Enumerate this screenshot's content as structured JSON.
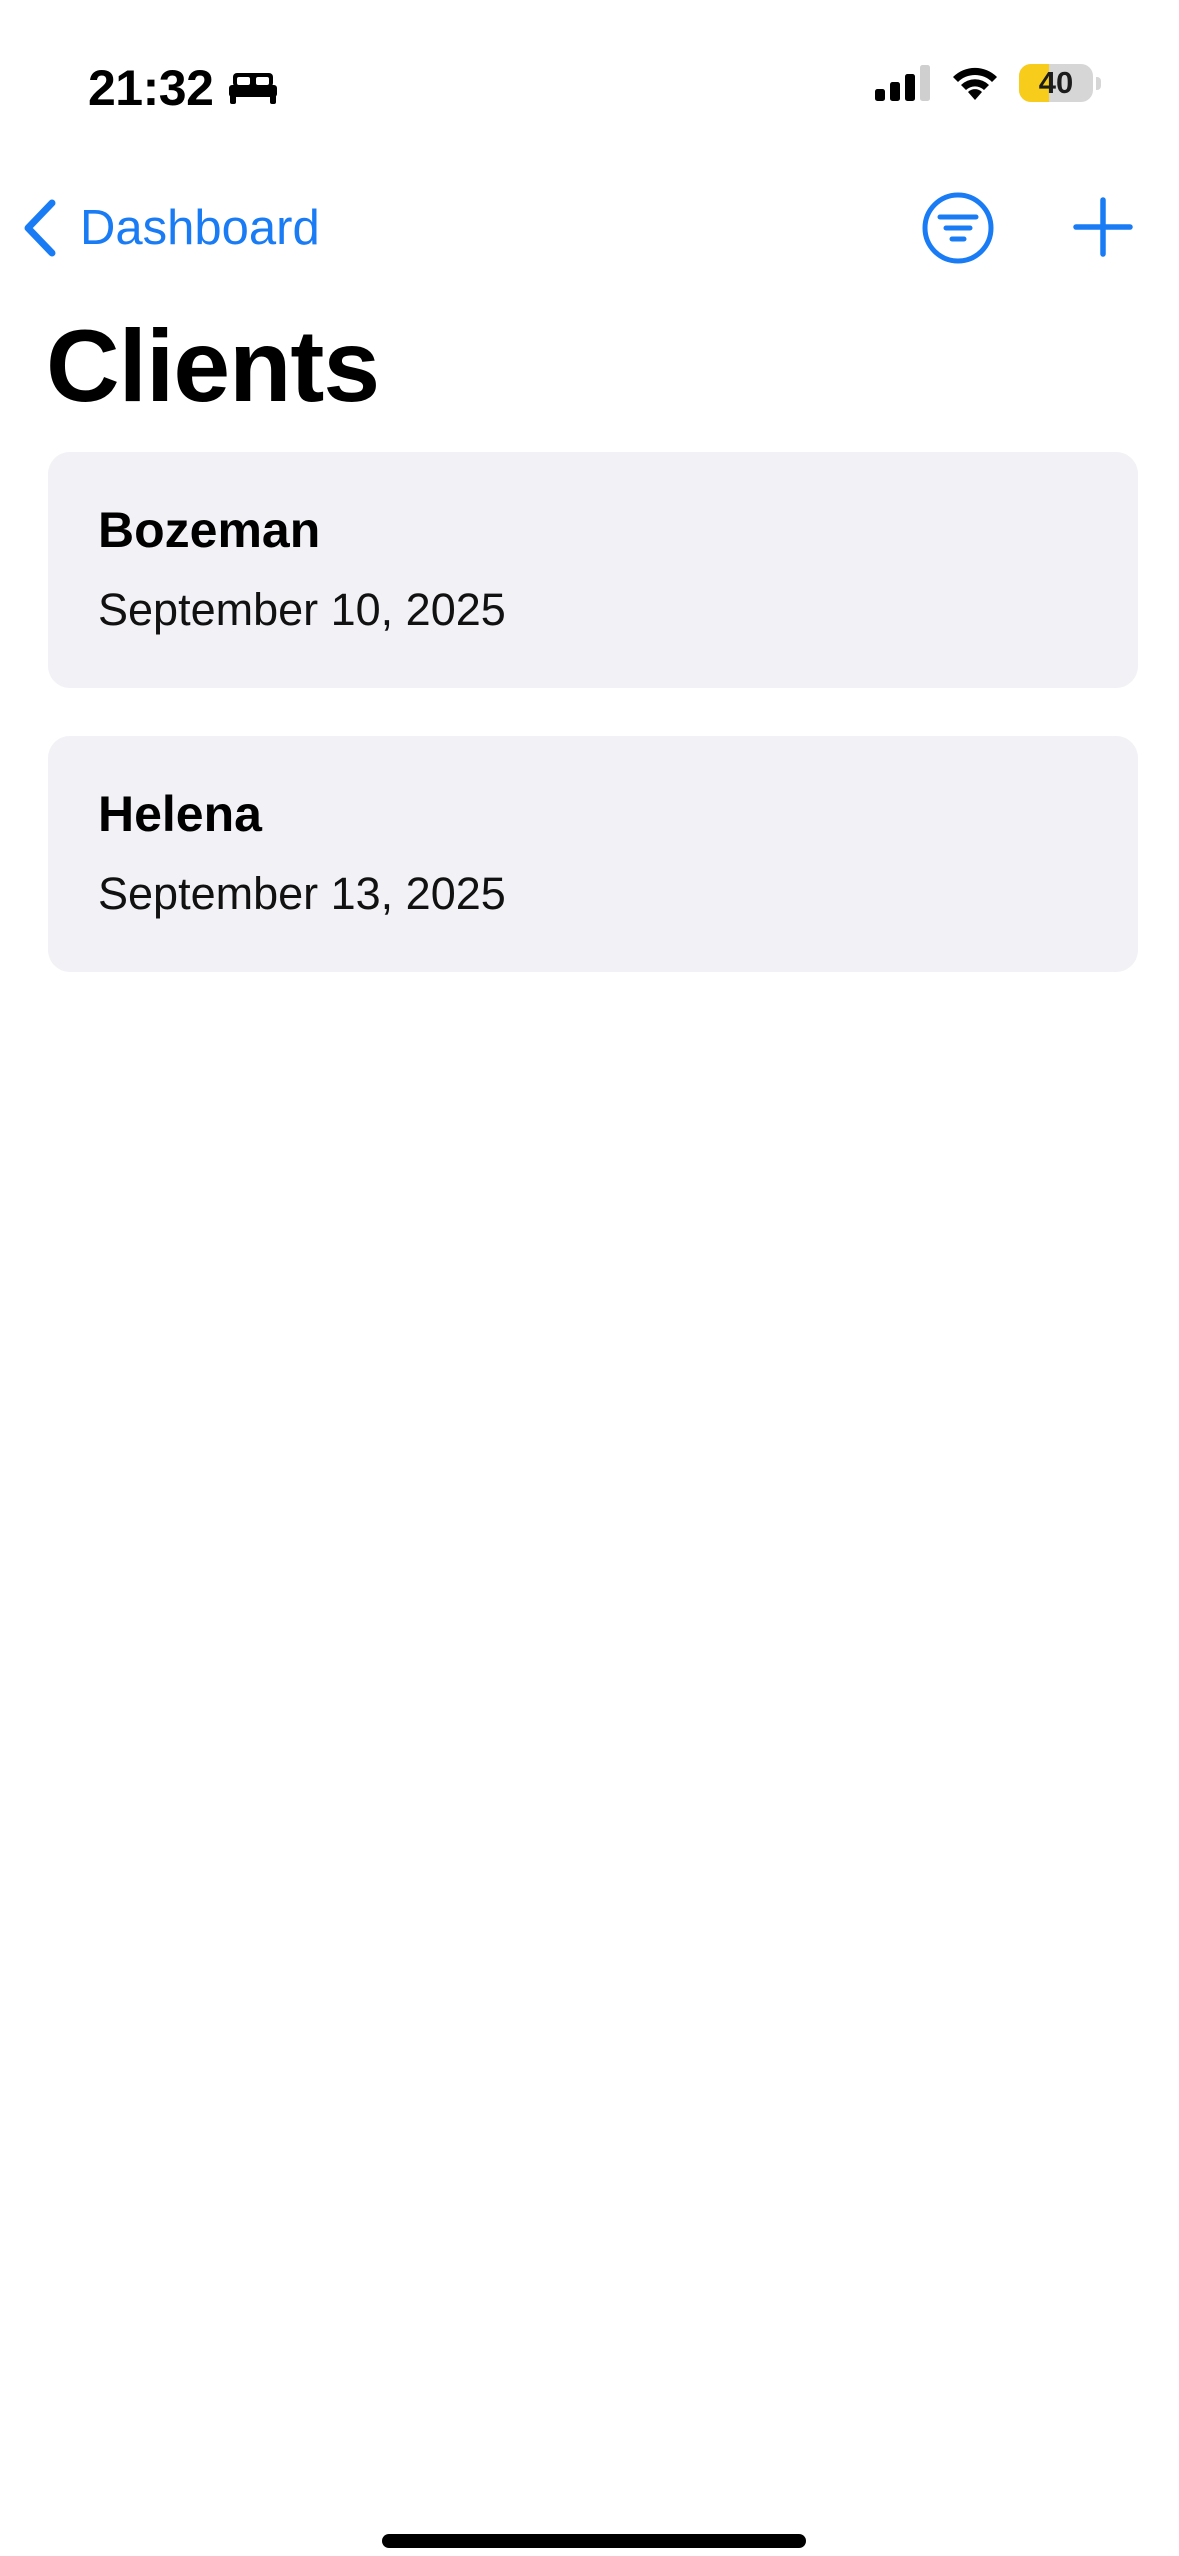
{
  "status_bar": {
    "time": "21:32",
    "focus_icon": "bed-icon",
    "battery_level": "40",
    "battery_fraction": 0.4,
    "battery_color": "#f8cc1b"
  },
  "nav": {
    "back_label": "Dashboard",
    "back_icon": "chevron-left-icon",
    "filter_icon": "filter-circle-icon",
    "add_icon": "plus-icon",
    "accent_color": "#1a7cf5"
  },
  "page": {
    "title": "Clients"
  },
  "clients": [
    {
      "name": "Bozeman",
      "date": "September 10, 2025"
    },
    {
      "name": "Helena",
      "date": "September 13, 2025"
    }
  ],
  "colors": {
    "card_background": "#f1f1f6",
    "background": "#ffffff"
  }
}
